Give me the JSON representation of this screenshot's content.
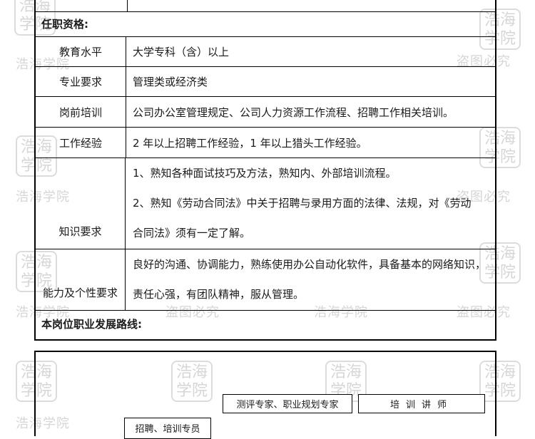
{
  "watermark": {
    "brand": "浩海学院",
    "seal": "浩海学院",
    "stamp": "盗图必究"
  },
  "qualifications": {
    "title": "任职资格:",
    "rows": [
      {
        "label": "教育水平",
        "value": "大学专科（含）以上"
      },
      {
        "label": "专业要求",
        "value": "管理类或经济类"
      },
      {
        "label": "岗前培训",
        "value": "公司办公室管理规定、公司人力资源工作流程、招聘工作相关培训。"
      },
      {
        "label": "工作经验",
        "value": "2 年以上招聘工作经验，1 年以上猎头工作经验。"
      },
      {
        "label": "知识要求",
        "lines": [
          "1、熟知各种面试技巧及方法，熟知内、外部培训流程。",
          "2、熟知《劳动合同法》中关于招聘与录用方面的法律、法规，对《劳动",
          "合同法》须有一定了解。"
        ]
      },
      {
        "label": "能力及个性要求",
        "lines": [
          "良好的沟通、协调能力，熟练使用办公自动化软件，具备基本的网络知识，",
          "责任心强，有团队精神，服从管理。"
        ]
      }
    ]
  },
  "career": {
    "title": "本岗位职业发展路线:",
    "nodes": [
      {
        "label": "测评专家、职业规划专家"
      },
      {
        "label": "培训讲师"
      },
      {
        "label": "招聘、培训专员"
      }
    ]
  }
}
